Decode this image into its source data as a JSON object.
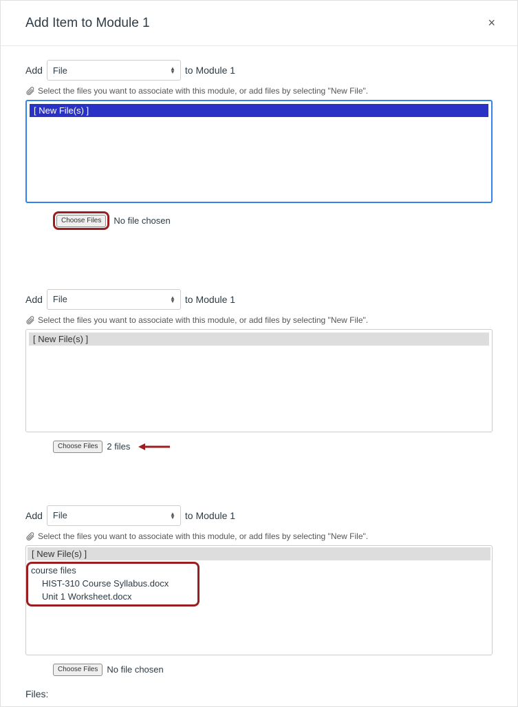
{
  "header": {
    "title": "Add Item to Module 1",
    "close": "×"
  },
  "section1": {
    "addLabel": "Add",
    "selectValue": "File",
    "toModule": "to Module 1",
    "hint": "Select the files you want to associate with this module, or add files by selecting \"New File\".",
    "newFiles": "[ New File(s) ]",
    "chooseFiles": "Choose Files",
    "noFile": "No file chosen"
  },
  "section2": {
    "addLabel": "Add",
    "selectValue": "File",
    "toModule": "to Module 1",
    "hint": "Select the files you want to associate with this module, or add files by selecting \"New File\".",
    "newFiles": "[ New File(s) ]",
    "chooseFiles": "Choose Files",
    "fileCount": "2 files"
  },
  "section3": {
    "addLabel": "Add",
    "selectValue": "File",
    "toModule": "to Module 1",
    "hint": "Select the files you want to associate with this module, or add files by selecting \"New File\".",
    "newFiles": "[ New File(s) ]",
    "folderLabel": "course files",
    "file1": "HIST-310 Course Syllabus.docx",
    "file2": "Unit 1 Worksheet.docx",
    "chooseFiles": "Choose Files",
    "noFile": "No file chosen"
  },
  "filesLabel": "Files:"
}
